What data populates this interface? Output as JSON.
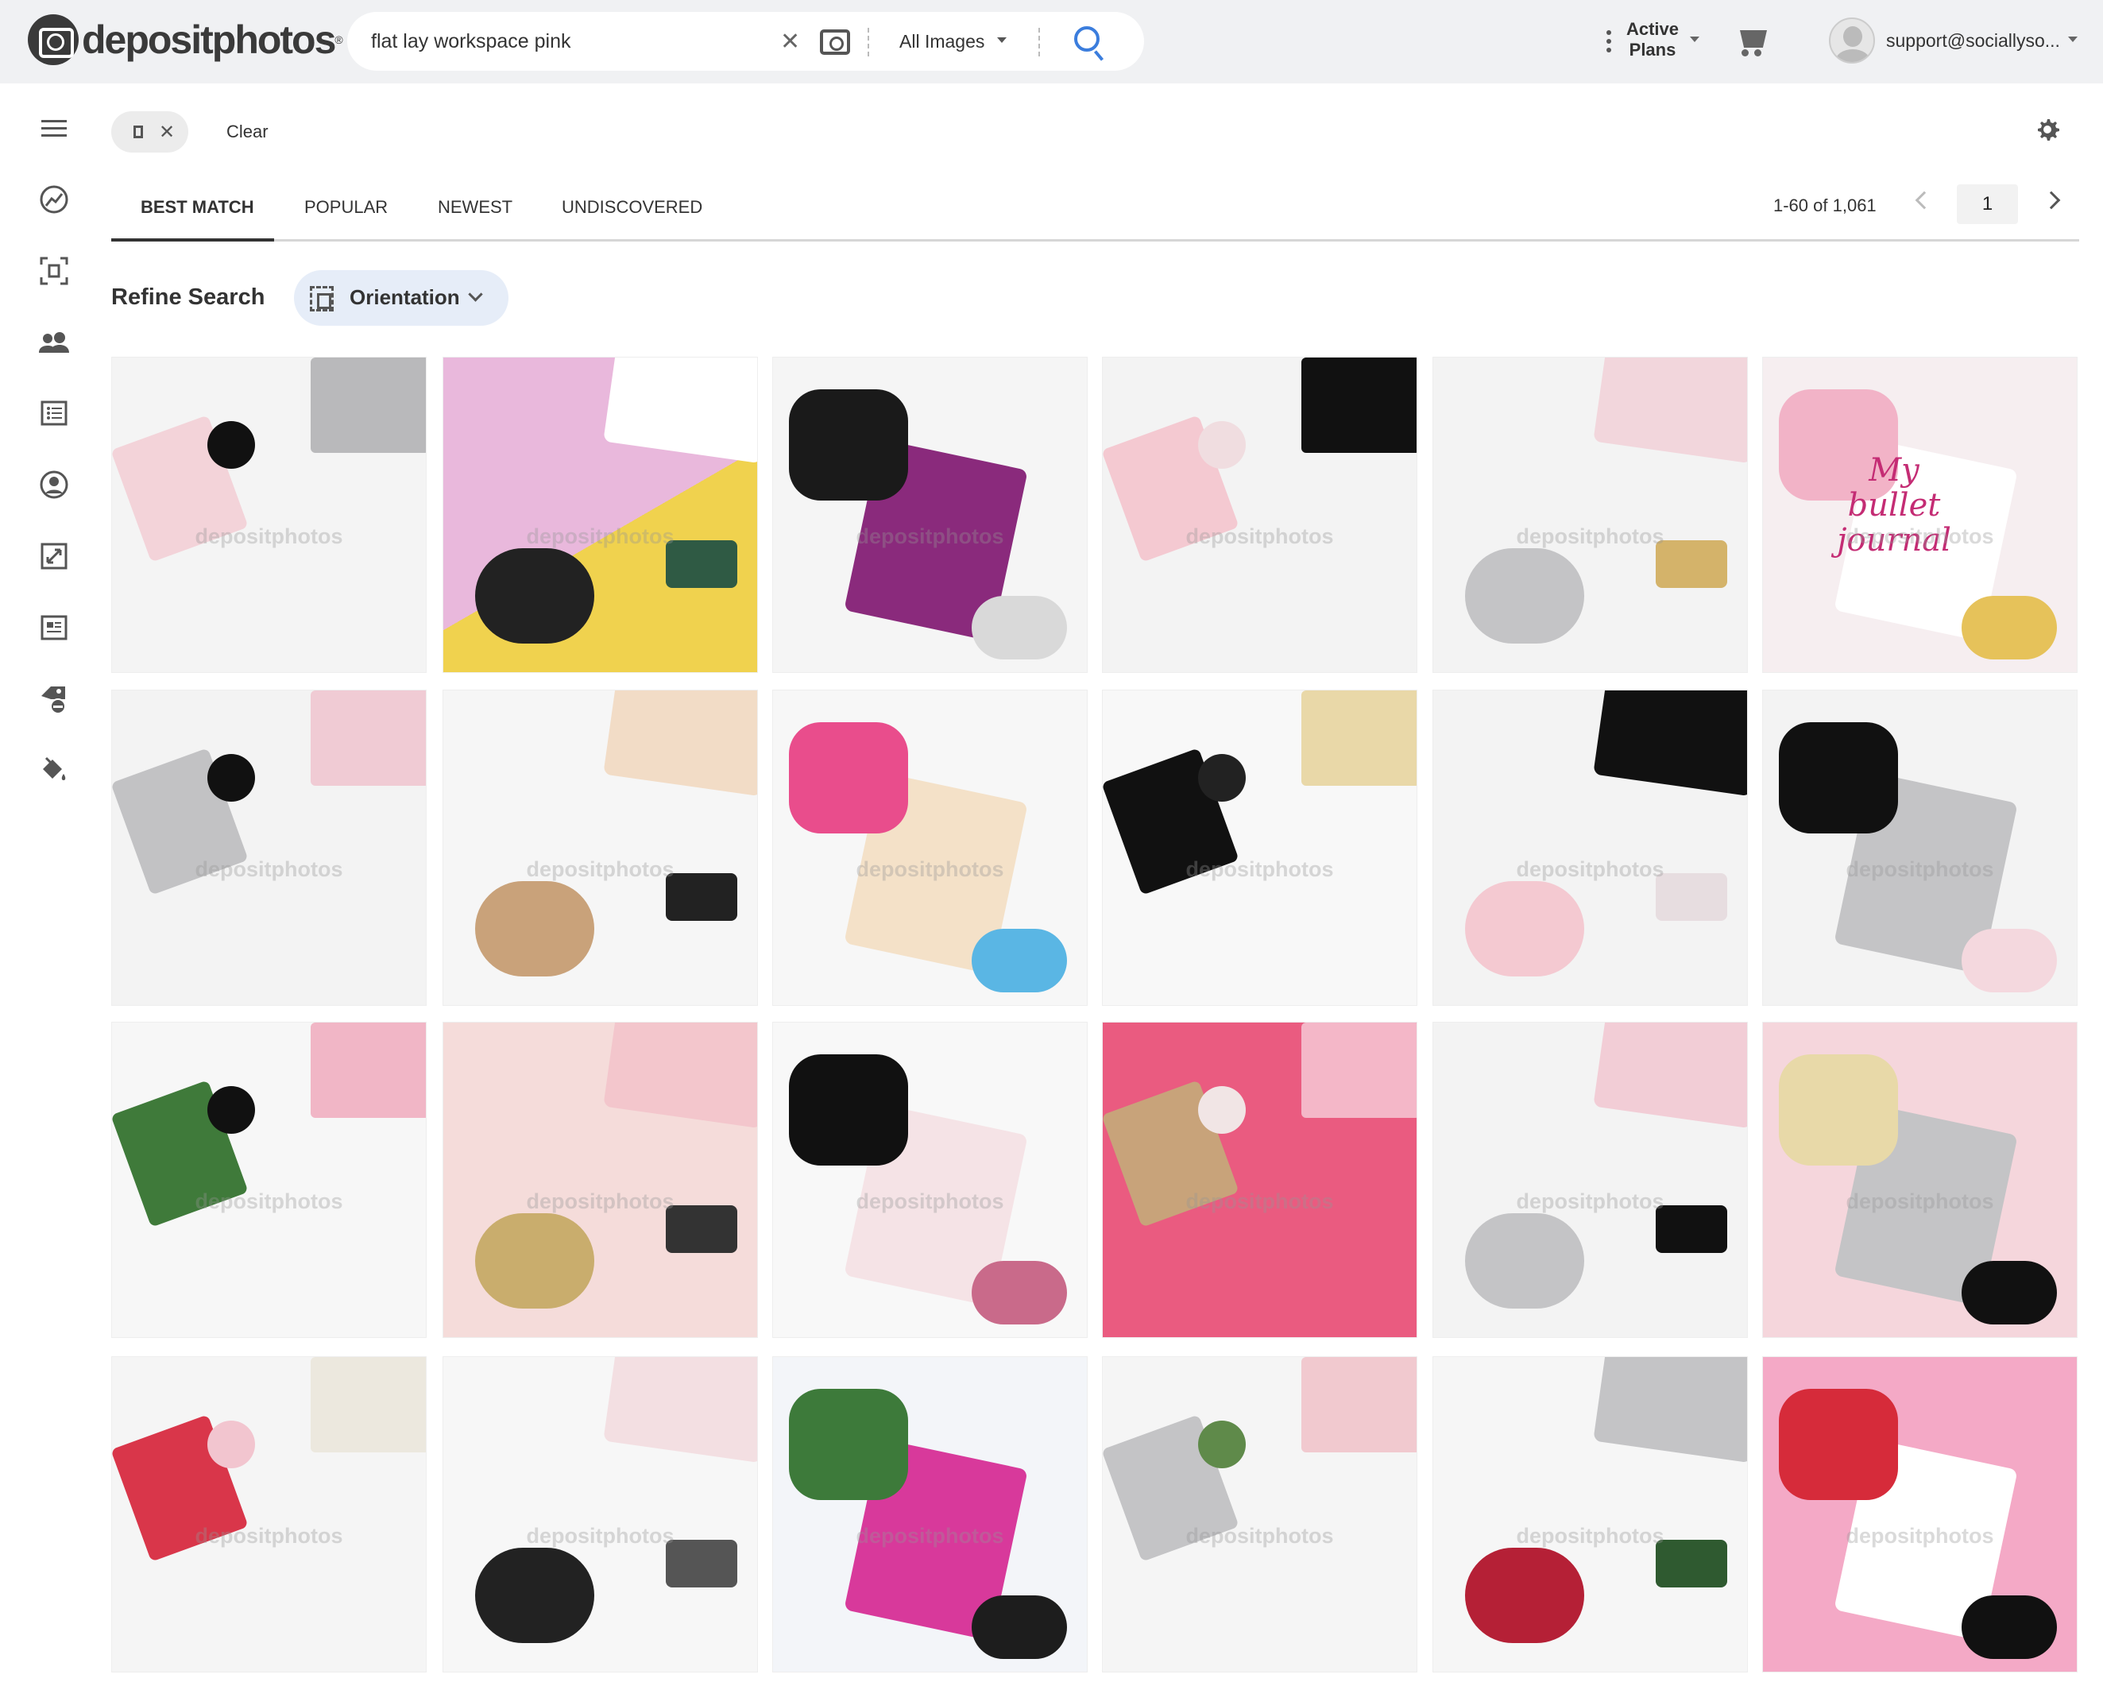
{
  "brand": {
    "name": "depositphotos",
    "reg": "®"
  },
  "search": {
    "query": "flat lay workspace pink",
    "clear_icon": "close-icon",
    "camera_icon": "camera-icon",
    "type_filter": "All Images",
    "search_icon": "search-icon",
    "accent": "#3b7ddd"
  },
  "header": {
    "plans_line1": "Active",
    "plans_line2": "Plans",
    "user_email": "support@sociallyso..."
  },
  "sidebar": {
    "items": [
      "menu-icon",
      "trending-icon",
      "focus-icon",
      "people-icon",
      "list-icon",
      "account-circle-icon",
      "resize-icon",
      "article-icon",
      "tag-remove-icon",
      "paint-bucket-icon"
    ]
  },
  "filters": {
    "chip_icon": "vertical-orientation-icon",
    "clear_label": "Clear"
  },
  "tabs": [
    {
      "label": "Best Match",
      "active": true
    },
    {
      "label": "Popular"
    },
    {
      "label": "Newest"
    },
    {
      "label": "Undiscovered"
    }
  ],
  "pagination": {
    "range": "1-60 of 1,061",
    "page": "1"
  },
  "refine": {
    "label": "Refine Search",
    "orientation_label": "Orientation"
  },
  "watermark": "depositphotos",
  "images": [
    {
      "bg": "#f4f4f4",
      "accents": [
        "#f3d3d9",
        "#b9b9bb",
        "#111111"
      ]
    },
    {
      "bg": "#e9b8dc",
      "bg2": "#f0d24e",
      "accents": [
        "#222222",
        "#ffffff",
        "#2f5a44"
      ]
    },
    {
      "bg": "#f5f5f5",
      "accents": [
        "#8a2a7c",
        "#1a1a1a",
        "#d9d9d9"
      ]
    },
    {
      "bg": "#f3f3f3",
      "accents": [
        "#f4c9d1",
        "#111111",
        "#f0dde0"
      ]
    },
    {
      "bg": "#f3f3f3",
      "accents": [
        "#c4c4c6",
        "#f2d6dc",
        "#d4b36a"
      ]
    },
    {
      "bg": "#f6eef0",
      "accents": [
        "#ffffff",
        "#f2b3c7",
        "#e6c25a"
      ],
      "lettering": "My bullet journal"
    },
    {
      "bg": "#f3f3f3",
      "accents": [
        "#c2c2c4",
        "#f0cbd4",
        "#111111"
      ]
    },
    {
      "bg": "#f6f6f6",
      "accents": [
        "#c9a27a",
        "#f2dcc6",
        "#222222"
      ]
    },
    {
      "bg": "#f7f7f7",
      "accents": [
        "#f4e1c8",
        "#e94d8c",
        "#5ab6e4"
      ]
    },
    {
      "bg": "#f8f8f8",
      "accents": [
        "#111111",
        "#e9d8a8",
        "#222222"
      ]
    },
    {
      "bg": "#f3f3f3",
      "accents": [
        "#f4c9d1",
        "#111111",
        "#e7dde0"
      ]
    },
    {
      "bg": "#f3f3f3",
      "accents": [
        "#c4c4c6",
        "#111111",
        "#f4d8de"
      ]
    },
    {
      "bg": "#f7f7f7",
      "accents": [
        "#3f7a3a",
        "#f1b6c6",
        "#111111"
      ]
    },
    {
      "bg": "#f5dcda",
      "accents": [
        "#c9ad6d",
        "#f3c6cc",
        "#333333"
      ]
    },
    {
      "bg": "#f8f8f8",
      "accents": [
        "#f5e3e6",
        "#111111",
        "#c96a8a"
      ]
    },
    {
      "bg": "#ea5b80",
      "accents": [
        "#c8a37a",
        "#f4b7c8",
        "#f1e5e5"
      ]
    },
    {
      "bg": "#f3f3f3",
      "accents": [
        "#c4c4c6",
        "#f2cdd6",
        "#111111"
      ]
    },
    {
      "bg": "#f5d6dc",
      "accents": [
        "#c4c4c6",
        "#e8d9a8",
        "#111111"
      ]
    },
    {
      "bg": "#f5f5f5",
      "accents": [
        "#d9364a",
        "#ece8de",
        "#f2c5cf"
      ]
    },
    {
      "bg": "#f7f7f7",
      "accents": [
        "#222222",
        "#f3dfe2",
        "#555555"
      ]
    },
    {
      "bg": "#f3f5f9",
      "accents": [
        "#d8399b",
        "#3d7a3a",
        "#1d1d1d"
      ]
    },
    {
      "bg": "#f5f5f5",
      "accents": [
        "#c4c4c6",
        "#f1c9cf",
        "#5f8a4a"
      ]
    },
    {
      "bg": "#f6f6f6",
      "accents": [
        "#b52036",
        "#c4c4c6",
        "#2f5a30"
      ]
    },
    {
      "bg": "#f4a9c6",
      "accents": [
        "#ffffff",
        "#d62b3a",
        "#111111"
      ]
    }
  ]
}
